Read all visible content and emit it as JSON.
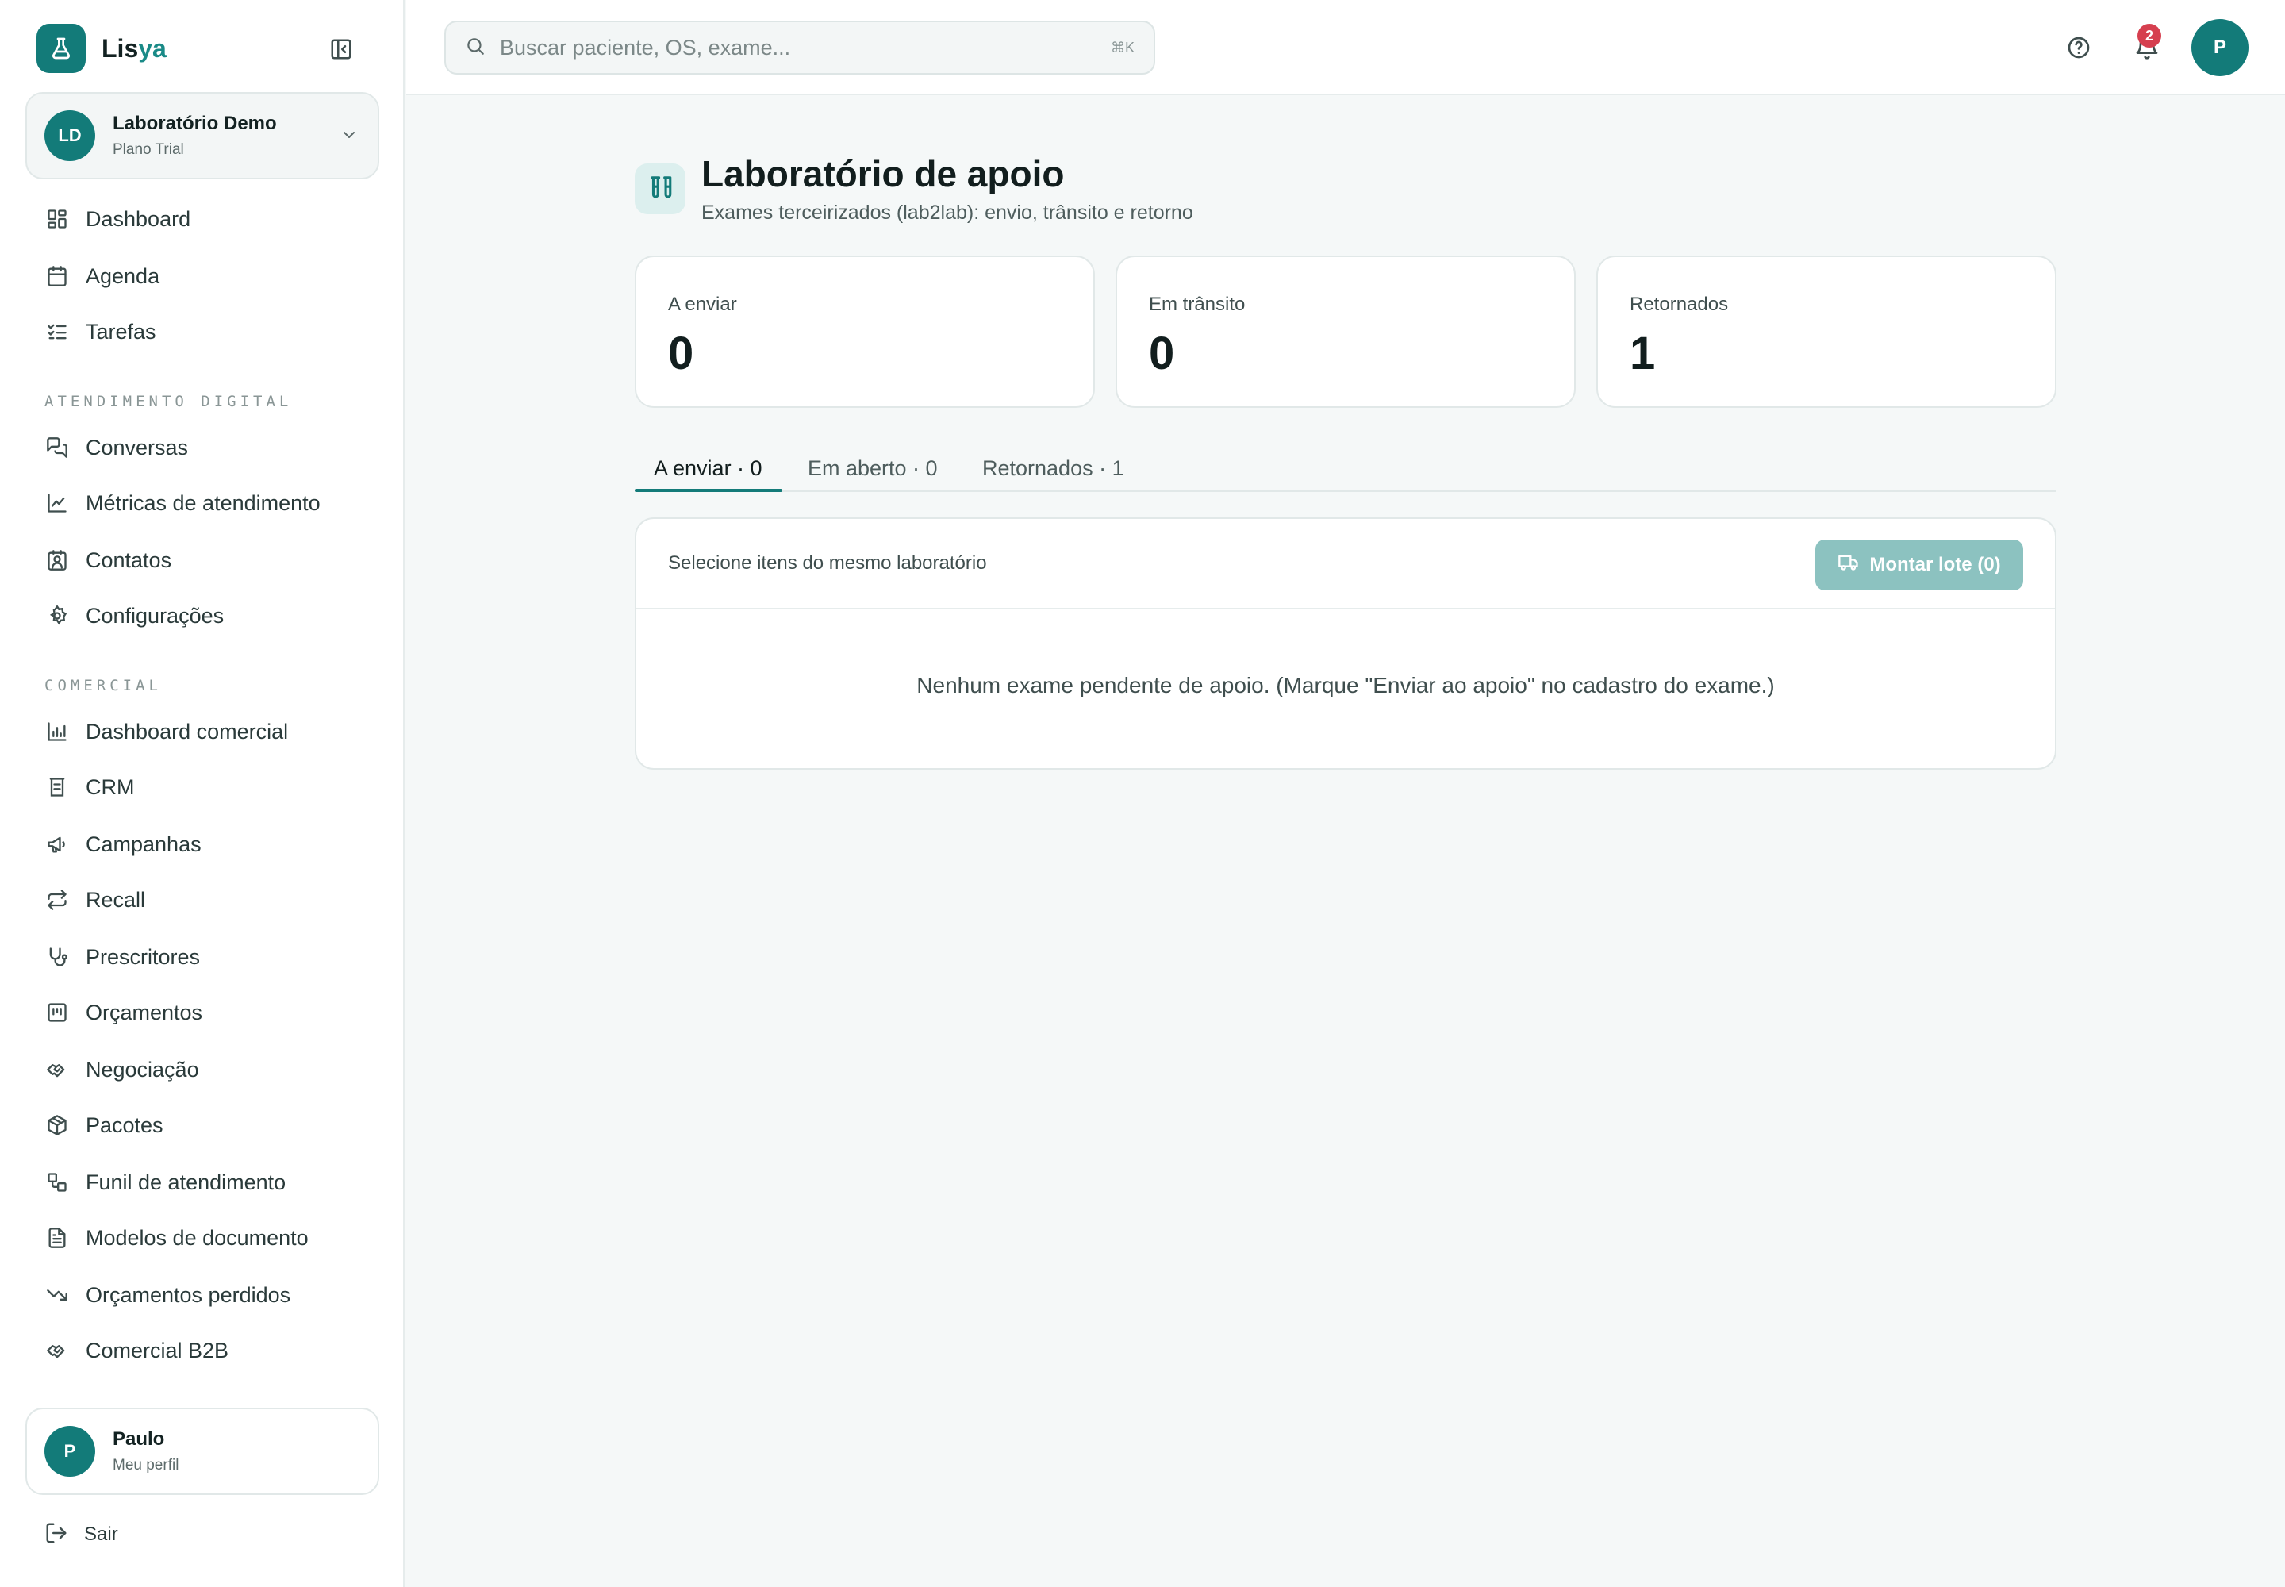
{
  "brand": {
    "name_prefix": "Lis",
    "name_suffix": "ya",
    "accent_color": "#137b79"
  },
  "org": {
    "initials": "LD",
    "name": "Laboratório Demo",
    "plan": "Plano Trial"
  },
  "nav": {
    "main": [
      {
        "label": "Dashboard",
        "icon": "dashboard-icon"
      },
      {
        "label": "Agenda",
        "icon": "calendar-icon"
      },
      {
        "label": "Tarefas",
        "icon": "list-check-icon"
      }
    ],
    "section_digital": "ATENDIMENTO DIGITAL",
    "digital": [
      {
        "label": "Conversas",
        "icon": "messages-icon"
      },
      {
        "label": "Métricas de atendimento",
        "icon": "line-chart-icon"
      },
      {
        "label": "Contatos",
        "icon": "contact-icon"
      },
      {
        "label": "Configurações",
        "icon": "gear-icon"
      }
    ],
    "section_comercial": "COMERCIAL",
    "comercial": [
      {
        "label": "Dashboard comercial",
        "icon": "bar-chart-icon"
      },
      {
        "label": "CRM",
        "icon": "crm-icon"
      },
      {
        "label": "Campanhas",
        "icon": "megaphone-icon"
      },
      {
        "label": "Recall",
        "icon": "repeat-icon"
      },
      {
        "label": "Prescritores",
        "icon": "stethoscope-icon"
      },
      {
        "label": "Orçamentos",
        "icon": "receipt-icon"
      },
      {
        "label": "Negociação",
        "icon": "handshake-icon"
      },
      {
        "label": "Pacotes",
        "icon": "package-icon"
      },
      {
        "label": "Funil de atendimento",
        "icon": "workflow-icon"
      },
      {
        "label": "Modelos de documento",
        "icon": "document-icon"
      },
      {
        "label": "Orçamentos perdidos",
        "icon": "trending-down-icon"
      },
      {
        "label": "Comercial B2B",
        "icon": "handshake-icon"
      }
    ]
  },
  "user": {
    "initial": "P",
    "name": "Paulo",
    "subtitle": "Meu perfil"
  },
  "logout_label": "Sair",
  "search": {
    "placeholder": "Buscar paciente, OS, exame...",
    "shortcut": "⌘K"
  },
  "header": {
    "notification_count": "2",
    "avatar_initial": "P"
  },
  "page": {
    "title": "Laboratório de apoio",
    "subtitle": "Exames terceirizados (lab2lab): envio, trânsito e retorno"
  },
  "stats": [
    {
      "label": "A enviar",
      "value": "0"
    },
    {
      "label": "Em trânsito",
      "value": "0"
    },
    {
      "label": "Retornados",
      "value": "1"
    }
  ],
  "tabs": [
    {
      "label": "A enviar · 0",
      "active": true
    },
    {
      "label": "Em aberto · 0",
      "active": false
    },
    {
      "label": "Retornados · 1",
      "active": false
    }
  ],
  "panel": {
    "hint": "Selecione itens do mesmo laboratório",
    "batch_button": "Montar lote (0)",
    "empty_message": "Nenhum exame pendente de apoio. (Marque \"Enviar ao apoio\" no cadastro do exame.)"
  }
}
